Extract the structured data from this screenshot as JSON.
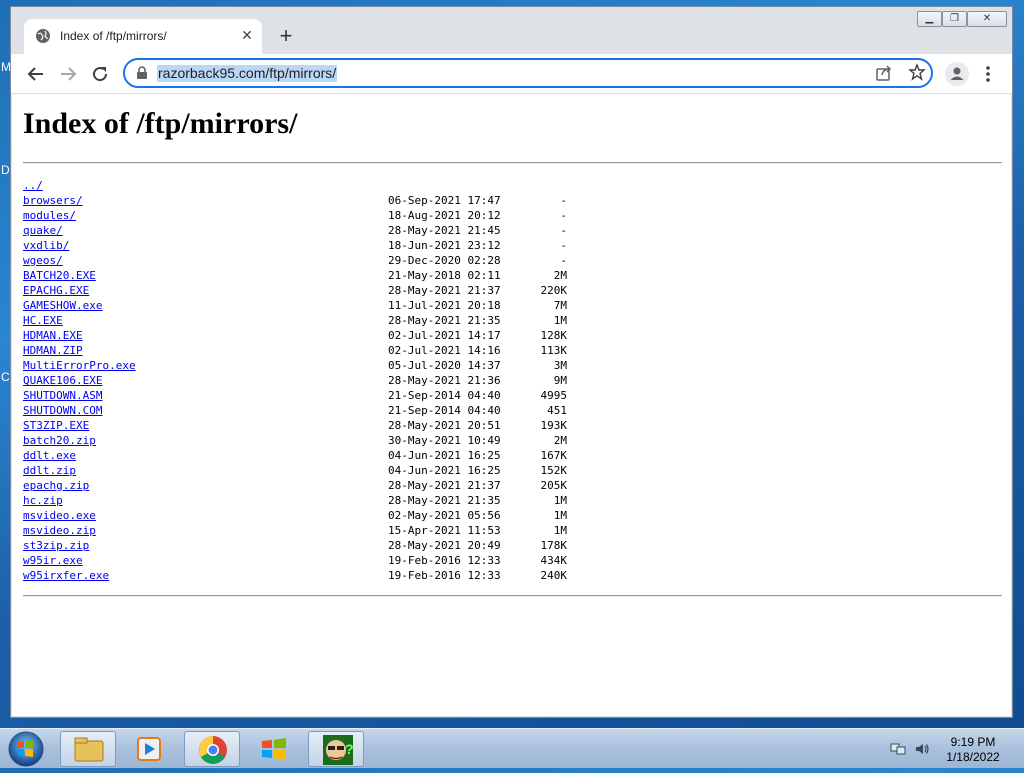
{
  "desktop": {
    "glyph_a": "M",
    "glyph_b": "D",
    "glyph_c": "C"
  },
  "browser": {
    "tab_title": "Index of /ftp/mirrors/",
    "url": "razorback95.com/ftp/mirrors/"
  },
  "page": {
    "heading": "Index of /ftp/mirrors/",
    "entries": [
      {
        "name": "../",
        "date": "",
        "size": ""
      },
      {
        "name": "browsers/",
        "date": "06-Sep-2021 17:47",
        "size": "-"
      },
      {
        "name": "modules/",
        "date": "18-Aug-2021 20:12",
        "size": "-"
      },
      {
        "name": "quake/",
        "date": "28-May-2021 21:45",
        "size": "-"
      },
      {
        "name": "vxdlib/",
        "date": "18-Jun-2021 23:12",
        "size": "-"
      },
      {
        "name": "wgeos/",
        "date": "29-Dec-2020 02:28",
        "size": "-"
      },
      {
        "name": "BATCH20.EXE",
        "date": "21-May-2018 02:11",
        "size": "2M"
      },
      {
        "name": "EPACHG.EXE",
        "date": "28-May-2021 21:37",
        "size": "220K"
      },
      {
        "name": "GAMESHOW.exe",
        "date": "11-Jul-2021 20:18",
        "size": "7M"
      },
      {
        "name": "HC.EXE",
        "date": "28-May-2021 21:35",
        "size": "1M"
      },
      {
        "name": "HDMAN.EXE",
        "date": "02-Jul-2021 14:17",
        "size": "128K"
      },
      {
        "name": "HDMAN.ZIP",
        "date": "02-Jul-2021 14:16",
        "size": "113K"
      },
      {
        "name": "MultiErrorPro.exe",
        "date": "05-Jul-2020 14:37",
        "size": "3M"
      },
      {
        "name": "QUAKE106.EXE",
        "date": "28-May-2021 21:36",
        "size": "9M"
      },
      {
        "name": "SHUTDOWN.ASM",
        "date": "21-Sep-2014 04:40",
        "size": "4995"
      },
      {
        "name": "SHUTDOWN.COM",
        "date": "21-Sep-2014 04:40",
        "size": "451"
      },
      {
        "name": "ST3ZIP.EXE",
        "date": "28-May-2021 20:51",
        "size": "193K"
      },
      {
        "name": "batch20.zip",
        "date": "30-May-2021 10:49",
        "size": "2M"
      },
      {
        "name": "ddlt.exe",
        "date": "04-Jun-2021 16:25",
        "size": "167K"
      },
      {
        "name": "ddlt.zip",
        "date": "04-Jun-2021 16:25",
        "size": "152K"
      },
      {
        "name": "epachg.zip",
        "date": "28-May-2021 21:37",
        "size": "205K"
      },
      {
        "name": "hc.zip",
        "date": "28-May-2021 21:35",
        "size": "1M"
      },
      {
        "name": "msvideo.exe",
        "date": "02-May-2021 05:56",
        "size": "1M"
      },
      {
        "name": "msvideo.zip",
        "date": "15-Apr-2021 11:53",
        "size": "1M"
      },
      {
        "name": "st3zip.zip",
        "date": "28-May-2021 20:49",
        "size": "178K"
      },
      {
        "name": "w95ir.exe",
        "date": "19-Feb-2016 12:33",
        "size": "434K"
      },
      {
        "name": "w95irxfer.exe",
        "date": "19-Feb-2016 12:33",
        "size": "240K"
      }
    ]
  },
  "taskbar": {
    "time": "9:19 PM",
    "date": "1/18/2022"
  },
  "colors": {
    "link": "#0000ee",
    "omnibox_focus": "#1a73e8",
    "url_selection": "#bcd6f5"
  }
}
